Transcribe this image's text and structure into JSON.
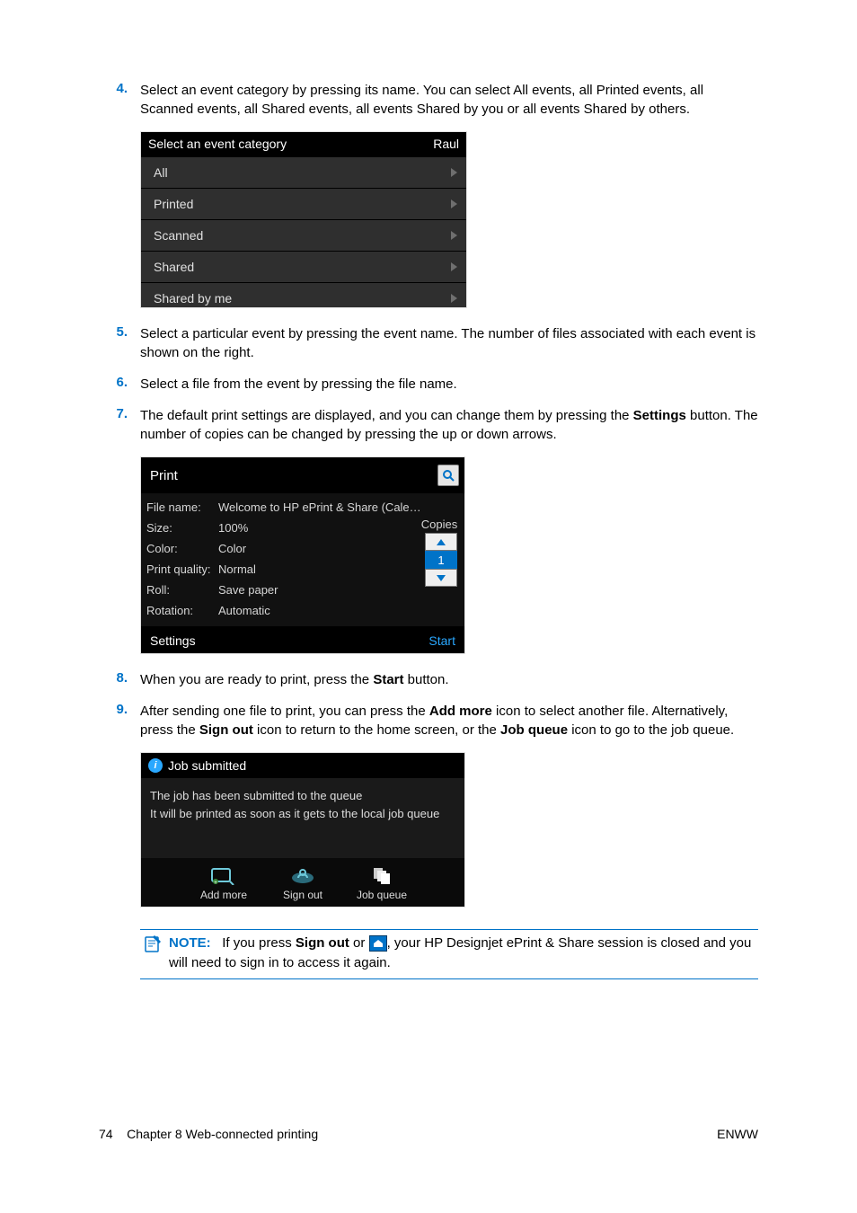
{
  "steps": {
    "s4": {
      "num": "4.",
      "text_a": "Select an event category by pressing its name. You can select All events, all Printed events, all Scanned events, all Shared events, all events Shared by you or all events Shared by others."
    },
    "s5": {
      "num": "5.",
      "text_a": "Select a particular event by pressing the event name. The number of files associated with each event is shown on the right."
    },
    "s6": {
      "num": "6.",
      "text_a": "Select a file from the event by pressing the file name."
    },
    "s7": {
      "num": "7.",
      "text_a_pre": "The default print settings are displayed, and you can change them by pressing the ",
      "bold1": "Settings",
      "text_a_post": " button. The number of copies can be changed by pressing the up or down arrows."
    },
    "s8": {
      "num": "8.",
      "pre": "When you are ready to print, press the ",
      "bold": "Start",
      "post": " button."
    },
    "s9": {
      "num": "9.",
      "p1_pre": "After sending one file to print, you can press the ",
      "b1": "Add more",
      "p1_mid": " icon to select another file. Alternatively, press the ",
      "b2": "Sign out",
      "p1_mid2": " icon to return to the home screen, or the ",
      "b3": "Job queue",
      "p1_post": " icon to go to the job queue."
    }
  },
  "shot1": {
    "title": "Select an event category",
    "user": "Raul",
    "rows": [
      "All",
      "Printed",
      "Scanned",
      "Shared",
      "Shared by me"
    ]
  },
  "shot2": {
    "title": "Print",
    "labels": {
      "file": "File name:",
      "size": "Size:",
      "color": "Color:",
      "quality": "Print quality:",
      "roll": "Roll:",
      "rotation": "Rotation:"
    },
    "values": {
      "file": "Welcome to HP ePrint & Share (Cale…",
      "size": "100%",
      "color": "Color",
      "quality": "Normal",
      "roll": "Save paper",
      "rotation": "Automatic"
    },
    "copies_label": "Copies",
    "copies_value": "1",
    "settings": "Settings",
    "start": "Start"
  },
  "shot3": {
    "title": "Job submitted",
    "body1": "The job has been submitted to the queue",
    "body2": "It will be printed as soon as it gets to the local job queue",
    "btns": {
      "add": "Add more",
      "signout": "Sign out",
      "queue": "Job queue"
    }
  },
  "note": {
    "label": "NOTE:",
    "pre": "If you press ",
    "b1": "Sign out",
    "mid": " or ",
    "post": ", your HP Designjet ePrint & Share session is closed and you will need to sign in to access it again."
  },
  "footer": {
    "page": "74",
    "chapter": "Chapter 8   Web-connected printing",
    "lang": "ENWW"
  }
}
